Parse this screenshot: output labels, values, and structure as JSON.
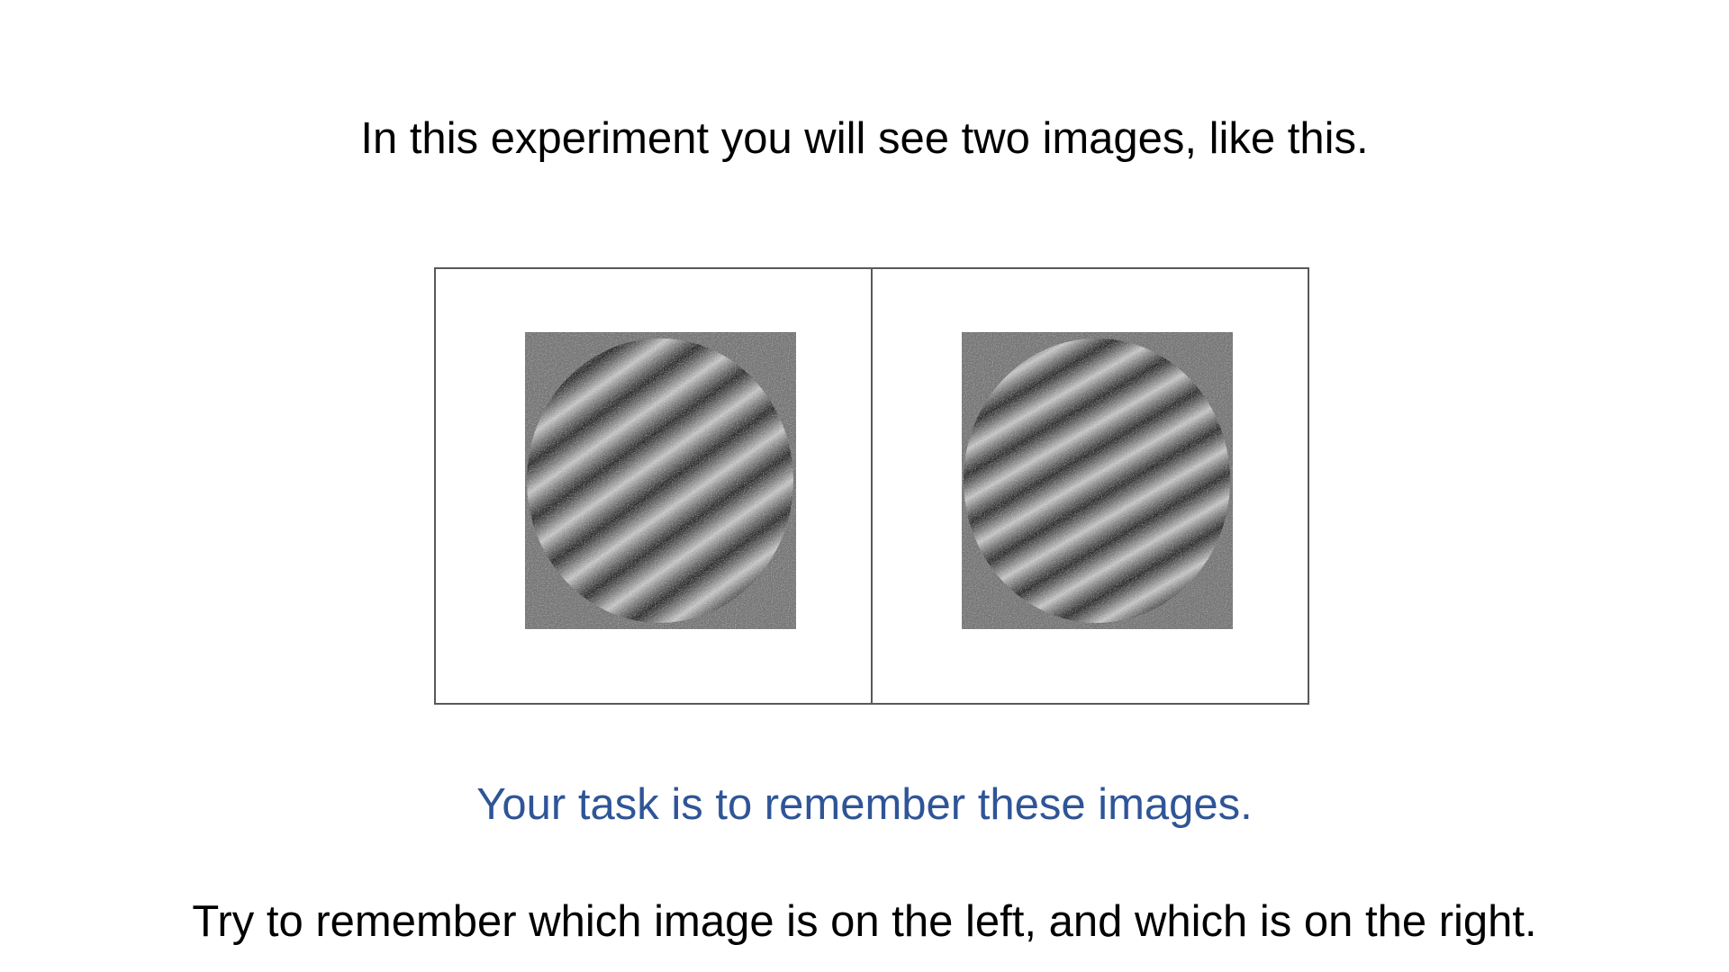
{
  "slide": {
    "intro": "In this experiment you will see two images, like this.",
    "task": "Your task is to remember these images.",
    "instruction": "Try to remember which image is on the left, and which is on the right."
  },
  "stimuli": [
    {
      "name": "left-grating",
      "orientation_deg": 55
    },
    {
      "name": "right-grating",
      "orientation_deg": 30
    }
  ],
  "colors": {
    "task_text": "#2f5597",
    "body_text": "#000000",
    "noise_background": "#7a7a7a",
    "panel_border": "#595959"
  }
}
